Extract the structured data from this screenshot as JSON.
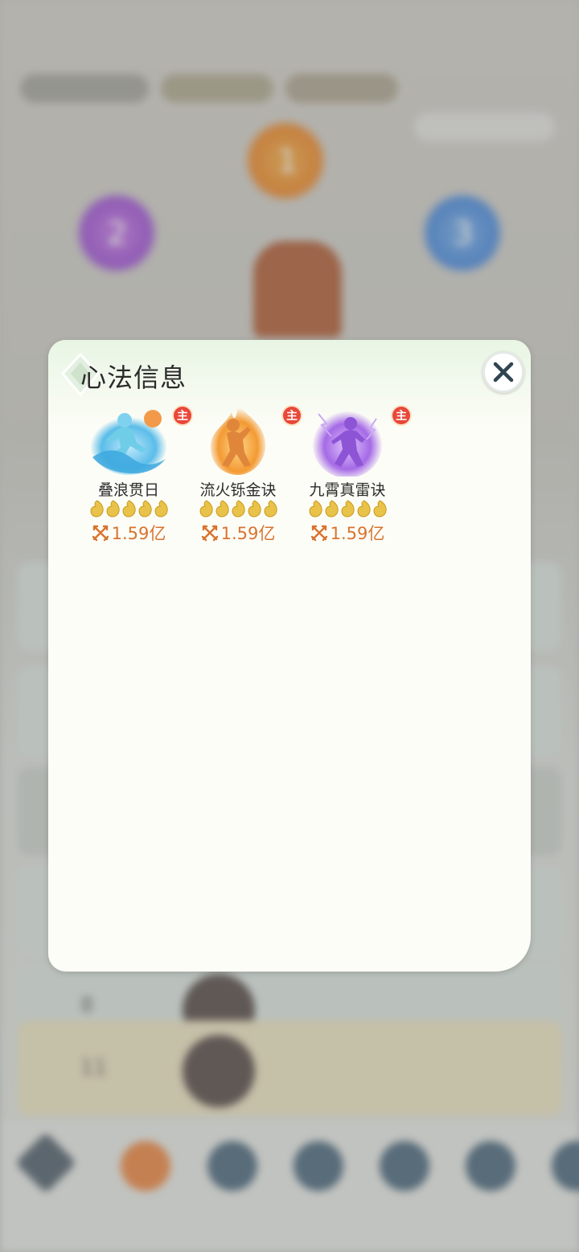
{
  "background": {
    "rank_badges": [
      "1",
      "2",
      "3"
    ],
    "list_rows": [
      {
        "rank": "8",
        "name": "",
        "power": ""
      },
      {
        "rank": "11",
        "name": "",
        "power": ""
      }
    ]
  },
  "dialog": {
    "title": "心法信息",
    "skills": [
      {
        "name": "叠浪贯日",
        "badge": "主",
        "stars": 5,
        "power": "1.59亿",
        "element": "water",
        "icon": "water-wave-figure-icon"
      },
      {
        "name": "流火铄金诀",
        "badge": "主",
        "stars": 5,
        "power": "1.59亿",
        "element": "fire",
        "icon": "fire-figure-icon"
      },
      {
        "name": "九霄真雷诀",
        "badge": "主",
        "stars": 5,
        "power": "1.59亿",
        "element": "thunder",
        "icon": "thunder-figure-icon"
      }
    ]
  },
  "colors": {
    "power_text": "#d8732f",
    "badge": "#e8473a",
    "star_gold": "#e9c24a",
    "water": "#4fb8e6",
    "fire": "#f0902e",
    "thunder": "#a66be8"
  }
}
